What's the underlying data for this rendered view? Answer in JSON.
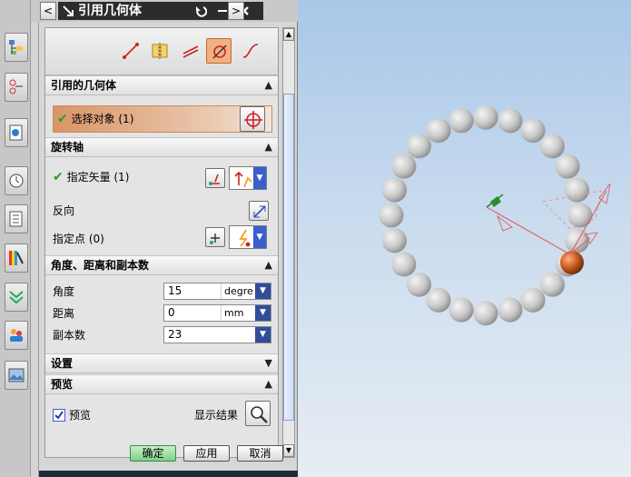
{
  "dialog": {
    "title": "引用几何体",
    "title_controls": [
      "<",
      ">"
    ],
    "sections": {
      "referenced_geometry": {
        "header": "引用的几何体",
        "select_object_label": "选择对象 (1)"
      },
      "rotation_axis": {
        "header": "旋转轴",
        "specify_vector_label": "指定矢量 (1)",
        "reverse_label": "反向",
        "specify_point_label": "指定点 (0)"
      },
      "angle_distance_copies": {
        "header": "角度、距离和副本数",
        "angle_label": "角度",
        "angle_value": "15",
        "angle_unit": "degre",
        "distance_label": "距离",
        "distance_value": "0",
        "distance_unit": "mm",
        "copies_label": "副本数",
        "copies_value": "23"
      },
      "settings": {
        "header": "设置"
      },
      "preview": {
        "header": "预览",
        "preview_checkbox_label": "预览",
        "preview_checked": true,
        "show_result_label": "显示结果"
      }
    },
    "buttons": {
      "ok": "确定",
      "apply": "应用",
      "cancel": "取消"
    }
  },
  "toolbar_icons": [
    "line-icon",
    "mirror-icon",
    "parallel-icon",
    "rotate-icon",
    "curve-icon"
  ],
  "colors": {
    "selection_gradient": "#d99566",
    "accent_blue": "#3a5fcd",
    "check_green": "#2e9b2e",
    "sphere_gray": "#c8c8c8",
    "sphere_highlight": "#c85a1e"
  }
}
